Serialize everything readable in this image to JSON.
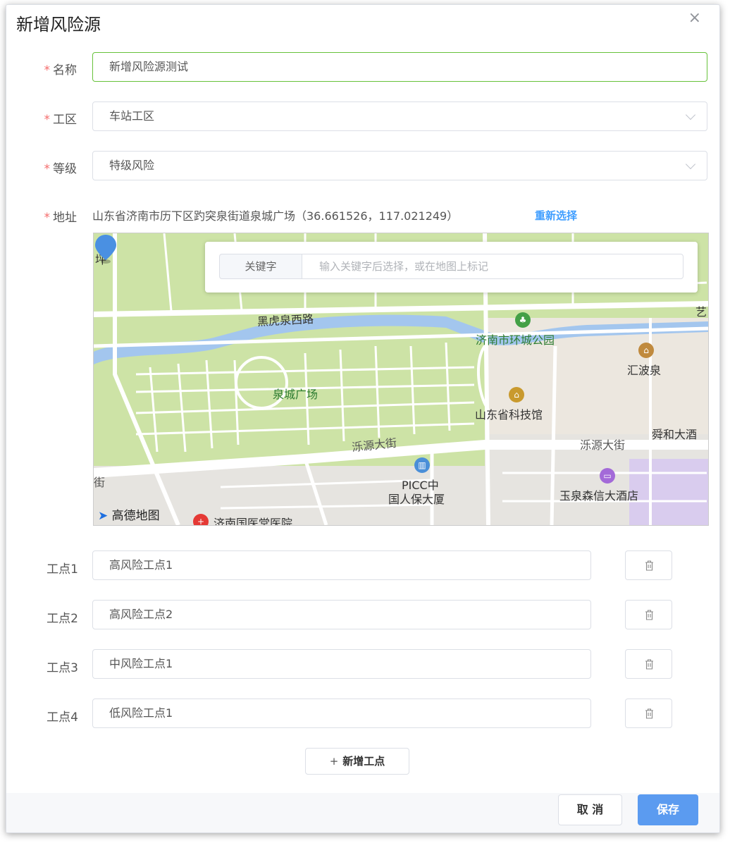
{
  "dialog": {
    "title": "新增风险源",
    "close_glyph": "×"
  },
  "form": {
    "required_mark": "*",
    "name": {
      "label": "名称",
      "value": "新增风险源测试"
    },
    "work_area": {
      "label": "工区",
      "value": "车站工区"
    },
    "level": {
      "label": "等级",
      "value": "特级风险"
    },
    "address": {
      "label": "地址",
      "value": "山东省济南市历下区趵突泉街道泉城广场（36.661526，117.021249）",
      "reselect_label": "重新选择"
    }
  },
  "map": {
    "search": {
      "keyword_button": "关键字",
      "placeholder": "输入关键字后选择，或在地图上标记"
    },
    "labels": {
      "ping": "坪",
      "heihuquan_road": "黑虎泉西路",
      "yi": "艺",
      "huancheng_park": "济南市环城公园",
      "huibo_spring": "汇波泉",
      "quancheng_square": "泉城广场",
      "science_museum": "山东省科技馆",
      "luoyuan_street_1": "泺源大街",
      "luoyuan_street_2": "泺源大街",
      "shunhe_hotel": "舜和大酒",
      "jie": "大街",
      "picc_1": "PICC中",
      "picc_2": "国人保大厦",
      "yuquan_hotel": "玉泉森信大酒店",
      "hospital": "济南国医堂医院",
      "brand": "高德地图"
    },
    "marker_color": "#4a90e2"
  },
  "work_points": [
    {
      "label": "工点1",
      "value": "高风险工点1"
    },
    {
      "label": "工点2",
      "value": "高风险工点2"
    },
    {
      "label": "工点3",
      "value": "中风险工点1"
    },
    {
      "label": "工点4",
      "value": "低风险工点1"
    }
  ],
  "actions": {
    "add_point_plus": "+",
    "add_point": "新增工点",
    "cancel": "取 消",
    "save": "保存"
  },
  "colors": {
    "primary": "#5b9bf0",
    "required": "#f56c6c",
    "link": "#409eff",
    "focus_border": "#67c23a"
  }
}
